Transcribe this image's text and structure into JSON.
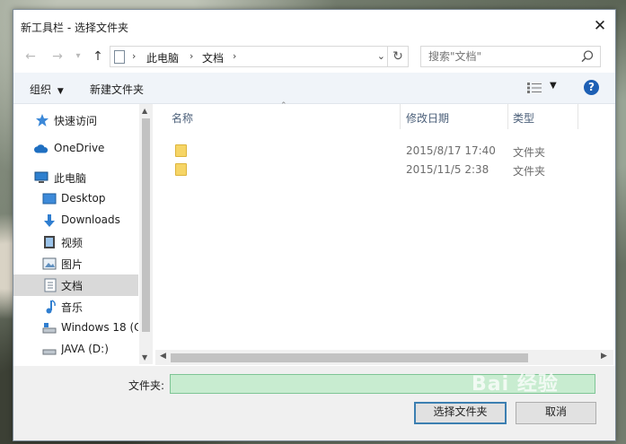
{
  "window": {
    "title": "新工具栏 - 选择文件夹"
  },
  "nav": {
    "breadcrumb": [
      "此电脑",
      "文档"
    ],
    "search_placeholder": "搜索\"文档\""
  },
  "toolbar": {
    "organize": "组织",
    "new_folder": "新建文件夹"
  },
  "sidebar": {
    "items": [
      {
        "label": "快速访问",
        "icon": "star-icon"
      },
      {
        "label": "OneDrive",
        "icon": "cloud-icon"
      },
      {
        "label": "此电脑",
        "icon": "computer-icon"
      },
      {
        "label": "Desktop",
        "icon": "desktop-icon"
      },
      {
        "label": "Downloads",
        "icon": "download-icon"
      },
      {
        "label": "视频",
        "icon": "video-icon"
      },
      {
        "label": "图片",
        "icon": "picture-icon"
      },
      {
        "label": "文档",
        "icon": "document-icon",
        "selected": true
      },
      {
        "label": "音乐",
        "icon": "music-icon"
      },
      {
        "label": "Windows 18 (C",
        "icon": "drive-icon"
      },
      {
        "label": "JAVA (D:)",
        "icon": "drive-icon"
      }
    ]
  },
  "columns": {
    "name": "名称",
    "modified": "修改日期",
    "type": "类型"
  },
  "files": [
    {
      "name": "",
      "modified": "2015/8/17 17:40",
      "type": "文件夹"
    },
    {
      "name": "",
      "modified": "2015/11/5 2:38",
      "type": "文件夹"
    }
  ],
  "footer": {
    "folder_label": "文件夹:",
    "folder_value": "",
    "select_button": "选择文件夹",
    "cancel_button": "取消"
  },
  "watermark": "Bai 经验",
  "colors": {
    "accent": "#1d5fb4",
    "selected_bg": "#d9d9d9",
    "input_fill": "#c8ecd0",
    "folder": "#f6d566"
  }
}
